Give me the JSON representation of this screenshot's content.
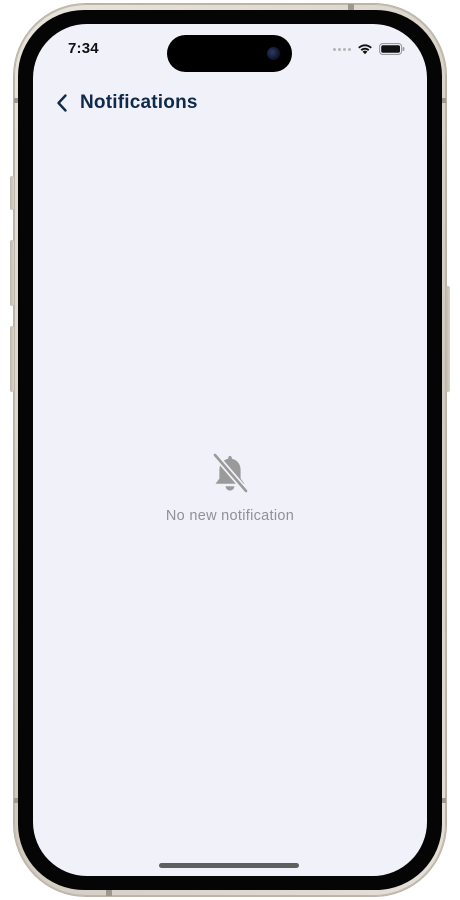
{
  "status_bar": {
    "time": "7:34",
    "icons": [
      "cellular-signal-icon",
      "wifi-icon",
      "battery-icon"
    ]
  },
  "header": {
    "back_icon": "chevron-left-icon",
    "title": "Notifications"
  },
  "empty_state": {
    "icon": "bell-off-icon",
    "message": "No new notification"
  },
  "colors": {
    "screen_background": "#f1f2f9",
    "title": "#0f2a4a",
    "muted_text": "#8f9196",
    "icon_gray": "#9a9a9a"
  }
}
